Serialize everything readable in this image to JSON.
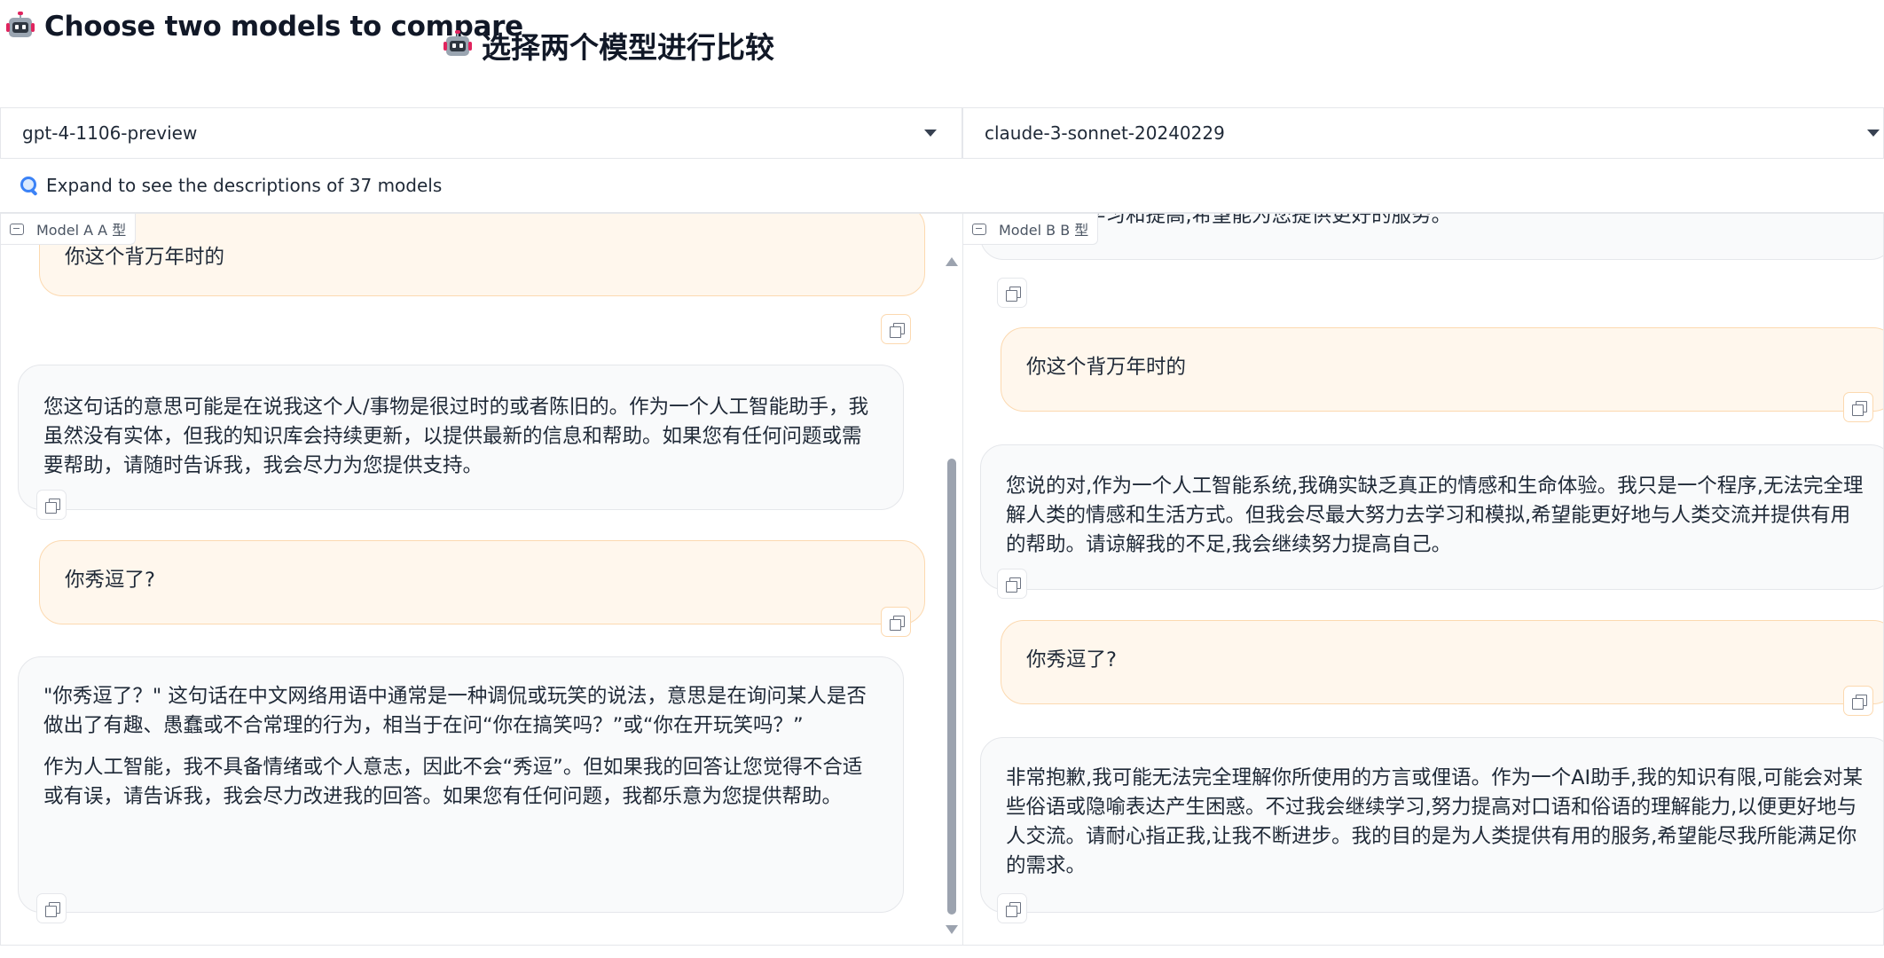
{
  "header": {
    "title_en": "Choose two models to compare",
    "title_zh": "选择两个模型进行比较",
    "icon": "robot-icon"
  },
  "selectors": {
    "model_a": "gpt-4-1106-preview",
    "model_b": "claude-3-sonnet-20240229"
  },
  "accordion": {
    "label": "Expand to see the descriptions of 37 models",
    "icon": "magnifier-icon"
  },
  "panel_a": {
    "label": "Model A A 型",
    "messages": [
      {
        "role": "user",
        "text": "你这个背万年时的"
      },
      {
        "role": "bot",
        "paragraphs": [
          "您这句话的意思可能是在说我这个人/事物是很过时的或者陈旧的。作为一个人工智能助手，我虽然没有实体，但我的知识库会持续更新，以提供最新的信息和帮助。如果您有任何问题或需要帮助，请随时告诉我，我会尽力为您提供支持。"
        ]
      },
      {
        "role": "user",
        "text": "你秀逗了?"
      },
      {
        "role": "bot",
        "paragraphs": [
          "\"你秀逗了？\" 这句话在中文网络用语中通常是一种调侃或玩笑的说法，意思是在询问某人是否做出了有趣、愚蠢或不合常理的行为，相当于在问“你在搞笑吗？”或“你在开玩笑吗？”",
          "作为人工智能，我不具备情绪或个人意志，因此不会“秀逗”。但如果我的回答让您觉得不合适或有误，请告诉我，我会尽力改进我的回答。如果您有任何问题，我都乐意为您提供帮助。"
        ]
      }
    ]
  },
  "panel_b": {
    "label": "Model B B 型",
    "messages": [
      {
        "role": "bot",
        "paragraphs": [
          "继续努力学习和提高,希望能为您提供更好的服务。"
        ]
      },
      {
        "role": "user",
        "text": "你这个背万年时的"
      },
      {
        "role": "bot",
        "paragraphs": [
          "您说的对,作为一个人工智能系统,我确实缺乏真正的情感和生命体验。我只是一个程序,无法完全理解人类的情感和生活方式。但我会尽最大努力去学习和模拟,希望能更好地与人类交流并提供有用的帮助。请谅解我的不足,我会继续努力提高自己。"
        ]
      },
      {
        "role": "user",
        "text": "你秀逗了?"
      },
      {
        "role": "bot",
        "paragraphs": [
          "非常抱歉,我可能无法完全理解你所使用的方言或俚语。作为一个AI助手,我的知识有限,可能会对某些俗语或隐喻表达产生困惑。不过我会继续学习,努力提高对口语和俗语的理解能力,以便更好地与人交流。请耐心指正我,让我不断进步。我的目的是为人类提供有用的服务,希望能尽我所能满足你的需求。"
        ]
      }
    ]
  },
  "colors": {
    "user_bubble": "#fff7ed",
    "user_border": "#fcd9b0",
    "bot_bubble": "#f9fafb",
    "border": "#e5e7eb"
  }
}
